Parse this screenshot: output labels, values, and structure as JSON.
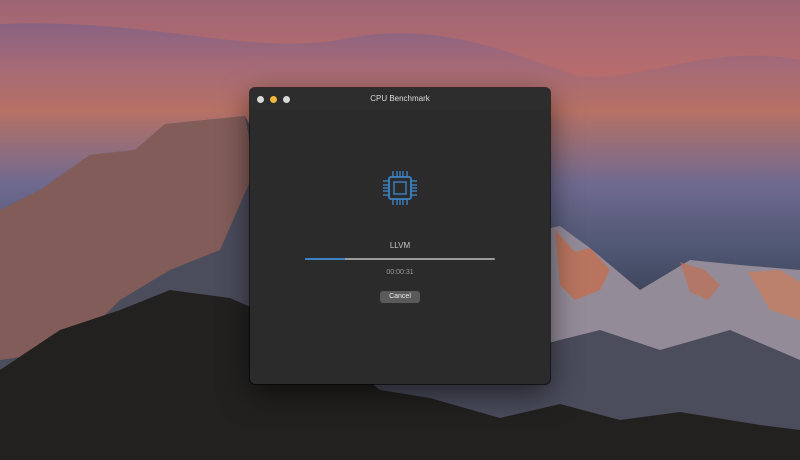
{
  "window": {
    "title": "CPU Benchmark",
    "task_label": "LLVM",
    "elapsed": "00:00:31",
    "progress": 0.21,
    "cancel_label": "Cancel"
  },
  "icons": {
    "main": "cpu-chip-icon",
    "window_controls": [
      "close",
      "minimize",
      "zoom"
    ]
  },
  "colors": {
    "accent": "#3b82c4",
    "window_bg": "#2b2b2b",
    "minimize_dot": "#f3b73c"
  }
}
